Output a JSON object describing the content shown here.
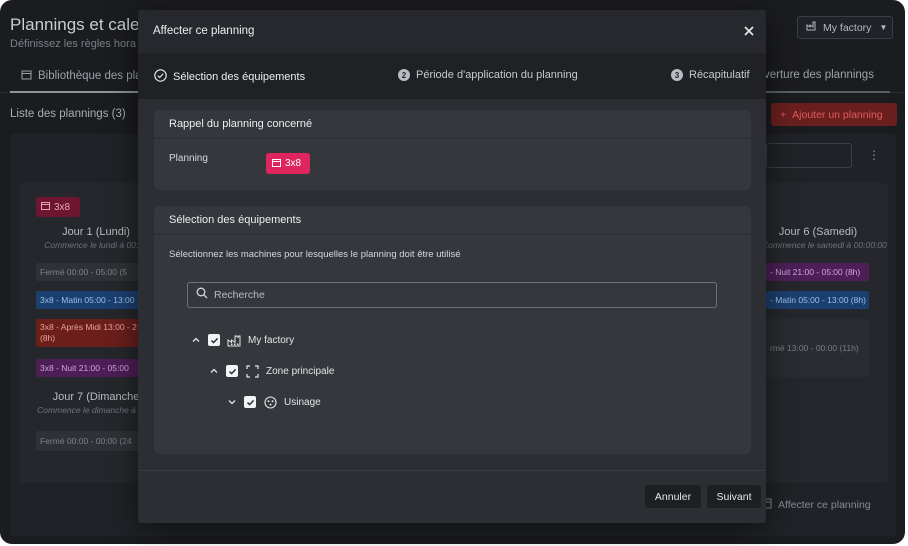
{
  "background": {
    "title": "Plannings et calen",
    "subtitle": "Définissez les règles hora",
    "factory_selector": "My factory",
    "tabs": [
      {
        "label": "Bibliothèque des pla"
      },
      {
        "label": "verture des plannings"
      }
    ],
    "list_title": "Liste des plannings (3)",
    "add_button": "Ajouter un planning",
    "planning_chip": "3x8",
    "days": [
      {
        "title": "Jour 1 (Lundi)",
        "sub": "Commence le lundi à 00:00"
      },
      {
        "title": "Jour 6 (Samedi)",
        "sub": "Commence le samedi à 00:00:00"
      },
      {
        "title": "Jour 7 (Dimanche",
        "sub": "Commence le dimanche à 00:0"
      }
    ],
    "slots": {
      "monday_ferme": "Fermé 00:00 - 05:00 (5",
      "monday_matin": "3x8 - Matin   05:00 - 13:00",
      "monday_aprem": "3x8 - Après Midi   13:00 - 2 (8h)",
      "monday_nuit": "3x8 - Nuit   21:00 - 05:00",
      "sunday_ferme": "Fermé 00:00 - 00:00 (24",
      "saturday_nuit": "- Nuit   21:00 - 05:00 (8h)",
      "saturday_matin": "- Matin   05:00 - 13:00 (8h)",
      "saturday_ferme": "rmé 13:00 - 00:00 (11h)"
    },
    "bottom_link": "Affecter ce planning"
  },
  "modal": {
    "title": "Affecter ce planning",
    "steps": [
      {
        "number": "",
        "label": "Sélection des équipements"
      },
      {
        "number": "2",
        "label": "Période d'application du planning"
      },
      {
        "number": "3",
        "label": "Récapitulatif"
      }
    ],
    "reminder": {
      "heading": "Rappel du planning concerné",
      "field_label": "Planning",
      "planning_name": "3x8"
    },
    "equipment": {
      "heading": "Sélection des équipements",
      "description": "Sélectionnez les machines pour lesquelles le planning doit être utilisé",
      "search_placeholder": "Recherche",
      "tree": [
        {
          "label": "My factory",
          "expanded": true,
          "checked": true,
          "icon": "factory-icon"
        },
        {
          "label": "Zone principale",
          "expanded": true,
          "checked": true,
          "icon": "zone-icon"
        },
        {
          "label": "Usinage",
          "expanded": false,
          "checked": true,
          "icon": "machine-icon"
        }
      ]
    },
    "footer": {
      "cancel": "Annuler",
      "next": "Suivant"
    }
  },
  "colors": {
    "accent_pink": "#e0245e",
    "modal_bg": "#2c2e33",
    "section_bg": "#35373d"
  }
}
